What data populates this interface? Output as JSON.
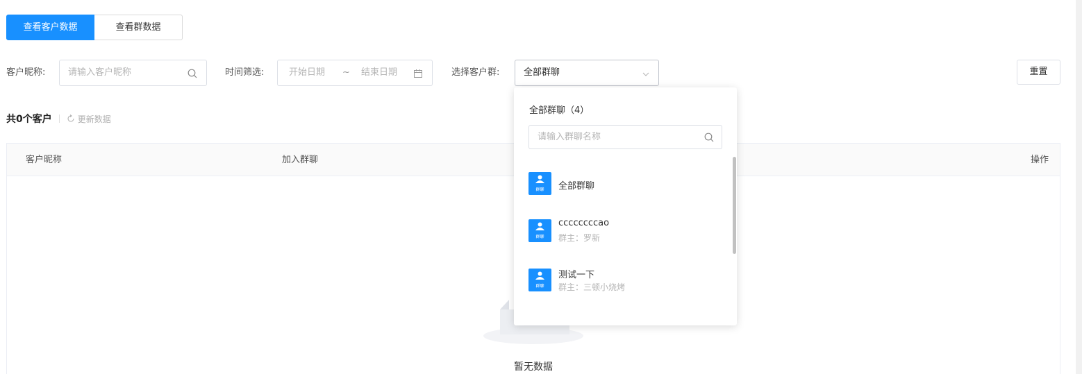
{
  "tabs": [
    {
      "label": "查看客户数据",
      "active": true
    },
    {
      "label": "查看群数据",
      "active": false
    }
  ],
  "filters": {
    "nickname_label": "客户昵称:",
    "nickname_placeholder": "请输入客户昵称",
    "time_label": "时间筛选:",
    "start_placeholder": "开始日期",
    "range_sep": "~",
    "end_placeholder": "结束日期",
    "group_label": "选择客户群:",
    "group_value": "全部群聊",
    "reset_label": "重置"
  },
  "summary": {
    "count_text": "共0个客户",
    "refresh_text": "更新数据"
  },
  "table": {
    "columns": [
      "客户昵称",
      "加入群聊",
      "操作"
    ],
    "empty_text": "暂无数据"
  },
  "dropdown": {
    "title": "全部群聊（4）",
    "search_placeholder": "请输入群聊名称",
    "icon_tag": "群聊",
    "items": [
      {
        "name": "全部群聊",
        "owner": ""
      },
      {
        "name": "ccccccccao",
        "owner": "群主：罗新"
      },
      {
        "name": "测试一下",
        "owner": "群主：三顿小烧烤"
      }
    ]
  },
  "colors": {
    "accent": "#1890ff",
    "border": "#dcdfe6",
    "placeholder": "#b5b5b5"
  },
  "icons": [
    "search-icon",
    "calendar-icon",
    "chevron-down-icon",
    "refresh-icon",
    "group-icon",
    "empty-box-icon"
  ]
}
